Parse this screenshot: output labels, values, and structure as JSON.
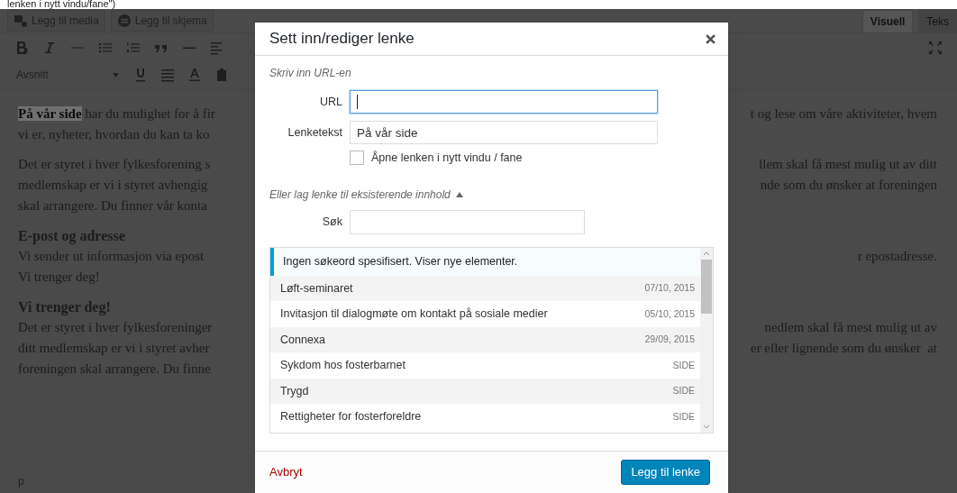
{
  "page_fragment": "lenken i nytt vindu/fane\")",
  "editor": {
    "media_buttons": [
      {
        "label": "Legg til media",
        "kind": "media"
      },
      {
        "label": "Legg til skjema",
        "kind": "form"
      }
    ],
    "tabs": [
      {
        "label": "Visuell",
        "selected": true
      },
      {
        "label": "Teks",
        "selected": false
      }
    ],
    "format_select": "Avsnitt",
    "lines": [
      {
        "kind": "text",
        "left": "**På vår side** har du mulighet for å fir",
        "right": "t og lese om våre aktiviteter, hvem"
      },
      {
        "kind": "text",
        "left": "vi er, nyheter, hvordan du kan ta ko"
      },
      {
        "kind": "gap"
      },
      {
        "kind": "text",
        "left": "Det er styret i hver fylkesforening s",
        "right": "llem skal få mest mulig ut av ditt"
      },
      {
        "kind": "text",
        "left": "medlemskap er vi i styret avhengig",
        "right": "nde som du ønsker at foreningen"
      },
      {
        "kind": "text",
        "left": "skal arrangere. Du finner vår konta"
      },
      {
        "kind": "gap"
      },
      {
        "kind": "heading",
        "left": "E-post og adresse"
      },
      {
        "kind": "text",
        "left": "Vi sender ut informasjon via epost",
        "right": "r epostadresse."
      },
      {
        "kind": "text",
        "left": "Vi trenger deg!"
      },
      {
        "kind": "gap"
      },
      {
        "kind": "heading",
        "left": "Vi trenger deg!"
      },
      {
        "kind": "text",
        "left": "Det er styret i hver fylkesforeninger",
        "right": "nedlem skal få mest mulig ut av"
      },
      {
        "kind": "text",
        "left": "ditt medlemskap er vi i styret avher",
        "right": "er eller lignende som du ønsker  at"
      },
      {
        "kind": "text",
        "left": "foreningen skal arrangere. Du finne"
      }
    ],
    "path": "p"
  },
  "dialog": {
    "title": "Sett inn/rediger lenke",
    "url_section": "Skriv inn URL-en",
    "url_field": {
      "label": "URL",
      "focused": true
    },
    "text_field": {
      "label": "Lenketekst",
      "value": "På vår side"
    },
    "new_tab": {
      "label": "Åpne lenken i nytt vindu / fane",
      "checked": false
    },
    "existing": {
      "label": "Eller lag lenke til eksisterende innhold",
      "expanded": true
    },
    "search_field": {
      "label": "Søk"
    },
    "notice": "Ingen søkeord spesifisert. Viser nye elementer.",
    "results": [
      {
        "title": "Løft-seminaret",
        "meta": "07/10, 2015"
      },
      {
        "title": "Invitasjon til dialogmøte om kontakt på sosiale medier",
        "meta": "05/10, 2015"
      },
      {
        "title": "Connexa",
        "meta": "29/09, 2015"
      },
      {
        "title": "Sykdom hos fosterbarnet",
        "meta": "SIDE"
      },
      {
        "title": "Trygd",
        "meta": "SIDE"
      },
      {
        "title": "Rettigheter for fosterforeldre",
        "meta": "SIDE"
      }
    ],
    "cancel": "Avbryt",
    "submit": "Legg til lenke"
  }
}
